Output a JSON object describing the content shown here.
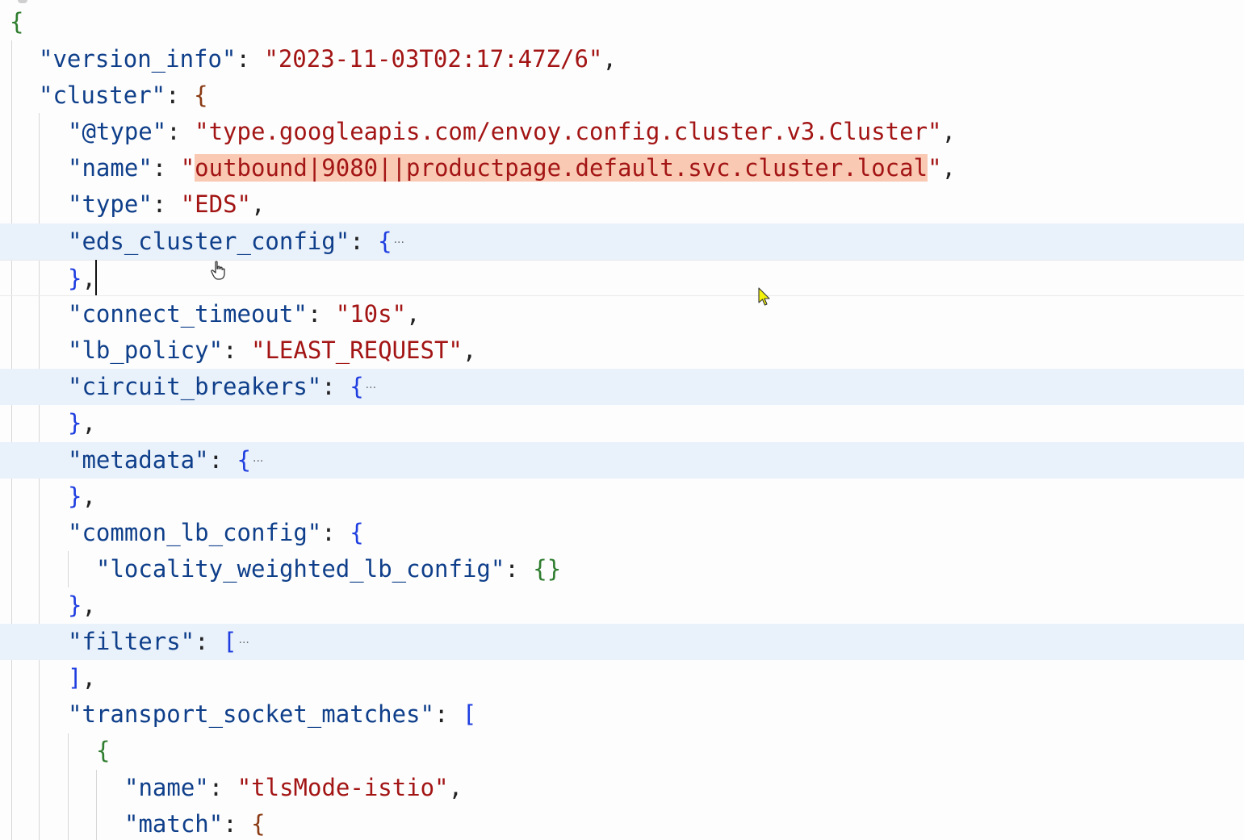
{
  "editor": {
    "lines": {
      "root_open": "{",
      "version_info": {
        "key": "\"version_info\"",
        "sep": ": ",
        "value": "\"2023-11-03T02:17:47Z/6\"",
        "comma": ","
      },
      "cluster": {
        "key": "\"cluster\"",
        "sep": ": ",
        "brace": "{"
      },
      "at_type": {
        "key": "\"@type\"",
        "sep": ": ",
        "value": "\"type.googleapis.com/envoy.config.cluster.v3.Cluster\"",
        "comma": ","
      },
      "name": {
        "key": "\"name\"",
        "sep": ": ",
        "quote_open": "\"",
        "value": "outbound|9080||productpage.default.svc.cluster.local",
        "quote_close": "\"",
        "comma": ","
      },
      "type": {
        "key": "\"type\"",
        "sep": ": ",
        "value": "\"EDS\"",
        "comma": ","
      },
      "eds_cluster_config": {
        "key": "\"eds_cluster_config\"",
        "sep": ": ",
        "brace": "{",
        "ellipsis": "···"
      },
      "eds_close": {
        "brace": "}",
        "comma": ","
      },
      "connect_timeout": {
        "key": "\"connect_timeout\"",
        "sep": ": ",
        "value": "\"10s\"",
        "comma": ","
      },
      "lb_policy": {
        "key": "\"lb_policy\"",
        "sep": ": ",
        "value": "\"LEAST_REQUEST\"",
        "comma": ","
      },
      "circuit_breakers": {
        "key": "\"circuit_breakers\"",
        "sep": ": ",
        "brace": "{",
        "ellipsis": "···"
      },
      "circuit_close": {
        "brace": "}",
        "comma": ","
      },
      "metadata": {
        "key": "\"metadata\"",
        "sep": ": ",
        "brace": "{",
        "ellipsis": "···"
      },
      "metadata_close": {
        "brace": "}",
        "comma": ","
      },
      "common_lb_config": {
        "key": "\"common_lb_config\"",
        "sep": ": ",
        "brace": "{"
      },
      "locality_weighted_lb_config": {
        "key": "\"locality_weighted_lb_config\"",
        "sep": ": ",
        "value": "{}"
      },
      "common_close": {
        "brace": "}",
        "comma": ","
      },
      "filters": {
        "key": "\"filters\"",
        "sep": ": ",
        "bracket": "[",
        "ellipsis": "···"
      },
      "filters_close": {
        "bracket": "]",
        "comma": ","
      },
      "transport_socket_matches": {
        "key": "\"transport_socket_matches\"",
        "sep": ": ",
        "bracket": "["
      },
      "tsm_item_open": "{",
      "tsm_name": {
        "key": "\"name\"",
        "sep": ": ",
        "value": "\"tlsMode-istio\"",
        "comma": ","
      },
      "tsm_match": {
        "key": "\"match\"",
        "sep": ": ",
        "brace": "{"
      }
    }
  }
}
